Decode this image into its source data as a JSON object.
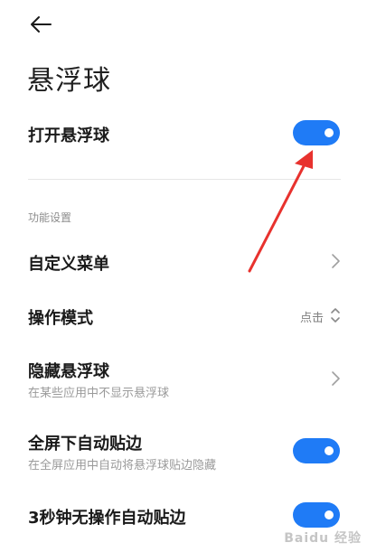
{
  "header": {
    "back_icon": "arrow-left-icon",
    "title": "悬浮球"
  },
  "main_toggle": {
    "label": "打开悬浮球",
    "on": true
  },
  "section": {
    "title": "功能设置"
  },
  "items": [
    {
      "label": "自定义菜单",
      "type": "link",
      "icon": "chevron-right-icon"
    },
    {
      "label": "操作模式",
      "type": "select",
      "value": "点击",
      "icon": "chevron-up-down-icon"
    },
    {
      "label": "隐藏悬浮球",
      "subtitle": "在某些应用中不显示悬浮球",
      "type": "link",
      "icon": "chevron-right-icon"
    },
    {
      "label": "全屏下自动贴边",
      "subtitle": "在全屏应用中自动将悬浮球贴边隐藏",
      "type": "toggle",
      "on": true
    },
    {
      "label": "3秒钟无操作自动贴边",
      "type": "toggle",
      "on": true
    }
  ],
  "colors": {
    "accent": "#1f7bf6",
    "annotation_arrow": "#e8322e"
  },
  "watermark": "Baidu 经验"
}
